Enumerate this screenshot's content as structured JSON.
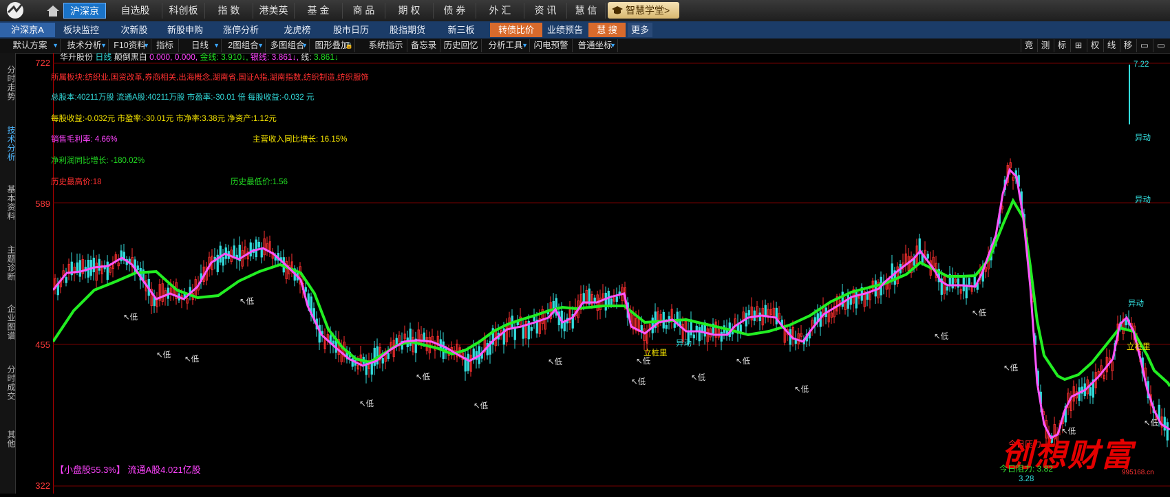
{
  "topbar": {
    "items": [
      "沪深京",
      "自选股",
      "科创板",
      "指 数",
      "港美英",
      "基 金",
      "商 品",
      "期 权",
      "债 券",
      "外 汇",
      "资 讯",
      "慧 信"
    ],
    "academy": "智慧学堂>"
  },
  "subnav": {
    "items": [
      "沪深京A",
      "板块监控",
      "次新股",
      "新股申购",
      "涨停分析",
      "龙虎榜",
      "股市日历",
      "股指期货",
      "新三板",
      "转债比价",
      "业绩预告",
      "慧 搜",
      "更多"
    ]
  },
  "toolbar": {
    "items": [
      "默认方案",
      "技术分析",
      "F10资料",
      "指标",
      "日线",
      "2图组合",
      "多图组合",
      "图形叠加",
      "系统指示",
      "备忘录",
      "历史回忆",
      "分析工具",
      "闪电预警",
      "普通坐标"
    ],
    "right": [
      "竞",
      "测",
      "标",
      "⊞",
      "权",
      "线",
      "移",
      "▭",
      "▭"
    ]
  },
  "sidebar": {
    "tabs": [
      "分时走势",
      "技术分析",
      "基本资料",
      "主题诊断",
      "企业图谱",
      "分时成交",
      "其他"
    ]
  },
  "yaxis": {
    "labels": [
      "722",
      "589",
      "455",
      "322"
    ]
  },
  "header": {
    "stock": "华升股份",
    "period": "日线",
    "indicator": "颠倒黑白",
    "values": "0.000, 0.000,",
    "gold_label": "金线:",
    "gold_val": "3.910↓,",
    "silver_label": "银线:",
    "silver_val": "3.861↓,",
    "line_label": "线:",
    "line_val": "3.861↓"
  },
  "info": {
    "sector": "所属板块:纺织业,国资改革,券商相关,出海概念,湖南省,国证A指,湖南指数,纺织制造,纺织服饰",
    "share": "总股本:40211万股 流通A股:40211万股 市盈率:-30.01 倍 每股收益:-0.032 元",
    "eps": "每股收益:-0.032元 市盈率:-30.01元 市净率:3.38元 净资产:1.12元",
    "gross": "销售毛利率: 4.66%",
    "revenue": "主营收入同比增长: 16.15%",
    "profit": "净利润同比增长: -180.02%",
    "hist_high": "历史最高价:18",
    "hist_low": "历史最低价:1.56"
  },
  "annotations": {
    "low": "低",
    "move": "异动",
    "pile": "立桩里",
    "peak": "7.22",
    "bottom": "3.28"
  },
  "bottom": {
    "size": "【小盘股55.3%】 流通A股4.021亿股",
    "resist": "今日阻力: 3.82",
    "resist2": "今日压力",
    "watermark": "创想财富",
    "url": "995168.cn"
  },
  "colors": {
    "gold": "#22ee22",
    "silver": "#ff66ff",
    "axis": "#ff3030",
    "up": "#ff3030",
    "down": "#33dddd"
  }
}
